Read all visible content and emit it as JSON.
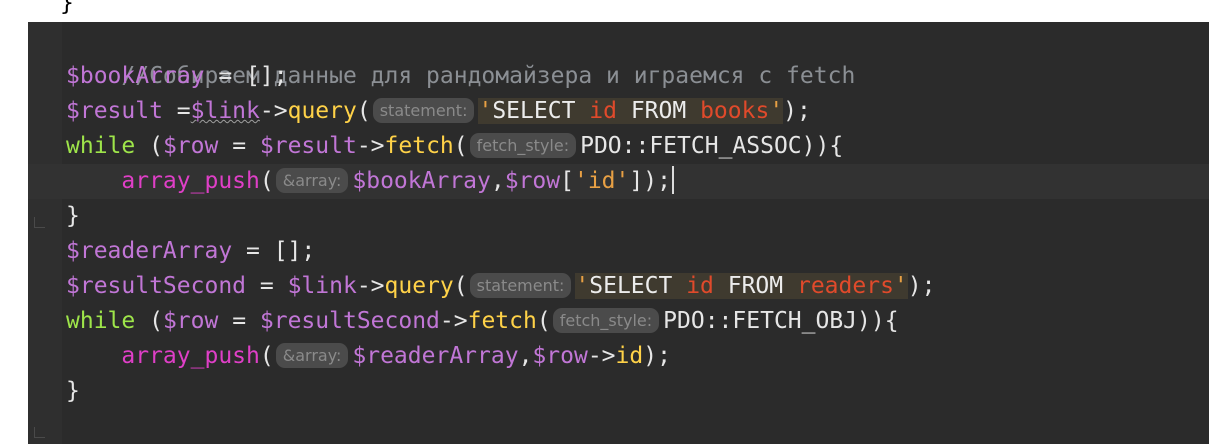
{
  "top_fragment": "}",
  "code": {
    "line1": {
      "comment": "//Собираем данные для рандомайзера и играемся с fetch"
    },
    "line2": {
      "var": "$bookArray",
      "rest": " = [];"
    },
    "line3": {
      "var": "$result",
      "op": " =",
      "obj": "$link",
      "arrow": "->",
      "method": "query",
      "paren": "(",
      "hint": "statement:",
      "q1": "'",
      "sql1": "SELECT ",
      "sql_id": "id",
      "sql2": " FROM ",
      "sql_table": "books",
      "q2": "'",
      "end": ");"
    },
    "line4": {
      "kw": "while",
      "p1": " (",
      "var1": "$row",
      "eq": " = ",
      "var2": "$result",
      "arrow": "->",
      "method": "fetch",
      "paren": "(",
      "hint": "fetch_style:",
      "const": "PDO::FETCH_ASSOC",
      "end": ")){"
    },
    "line5": {
      "indent": "    ",
      "fn": "array_push",
      "paren": "(",
      "hint": "&array:",
      "var1": "$bookArray",
      "comma": ",",
      "var2": "$row",
      "br1": "[",
      "key": "'id'",
      "br2": "]);"
    },
    "line6": {
      "text": "}"
    },
    "line7": {
      "var": "$readerArray",
      "rest": " = [];"
    },
    "line8": {
      "var": "$resultSecond",
      "eq": " = ",
      "obj": "$link",
      "arrow": "->",
      "method": "query",
      "paren": "(",
      "hint": "statement:",
      "q1": "'",
      "sql1": "SELECT ",
      "sql_id": "id",
      "sql2": " FROM ",
      "sql_table": "readers",
      "q2": "'",
      "end": ");"
    },
    "line9": {
      "kw": "while",
      "p1": " (",
      "var1": "$row",
      "eq": " = ",
      "var2": "$resultSecond",
      "arrow": "->",
      "method": "fetch",
      "paren": "(",
      "hint": "fetch_style:",
      "const": "PDO::FETCH_OBJ",
      "end": ")){"
    },
    "line10": {
      "indent": "    ",
      "fn": "array_push",
      "paren": "(",
      "hint": "&array:",
      "var1": "$readerArray",
      "comma": ",",
      "var2": "$row",
      "arrow": "->",
      "prop": "id",
      "end": ");"
    },
    "line11": {
      "text": "}"
    }
  }
}
